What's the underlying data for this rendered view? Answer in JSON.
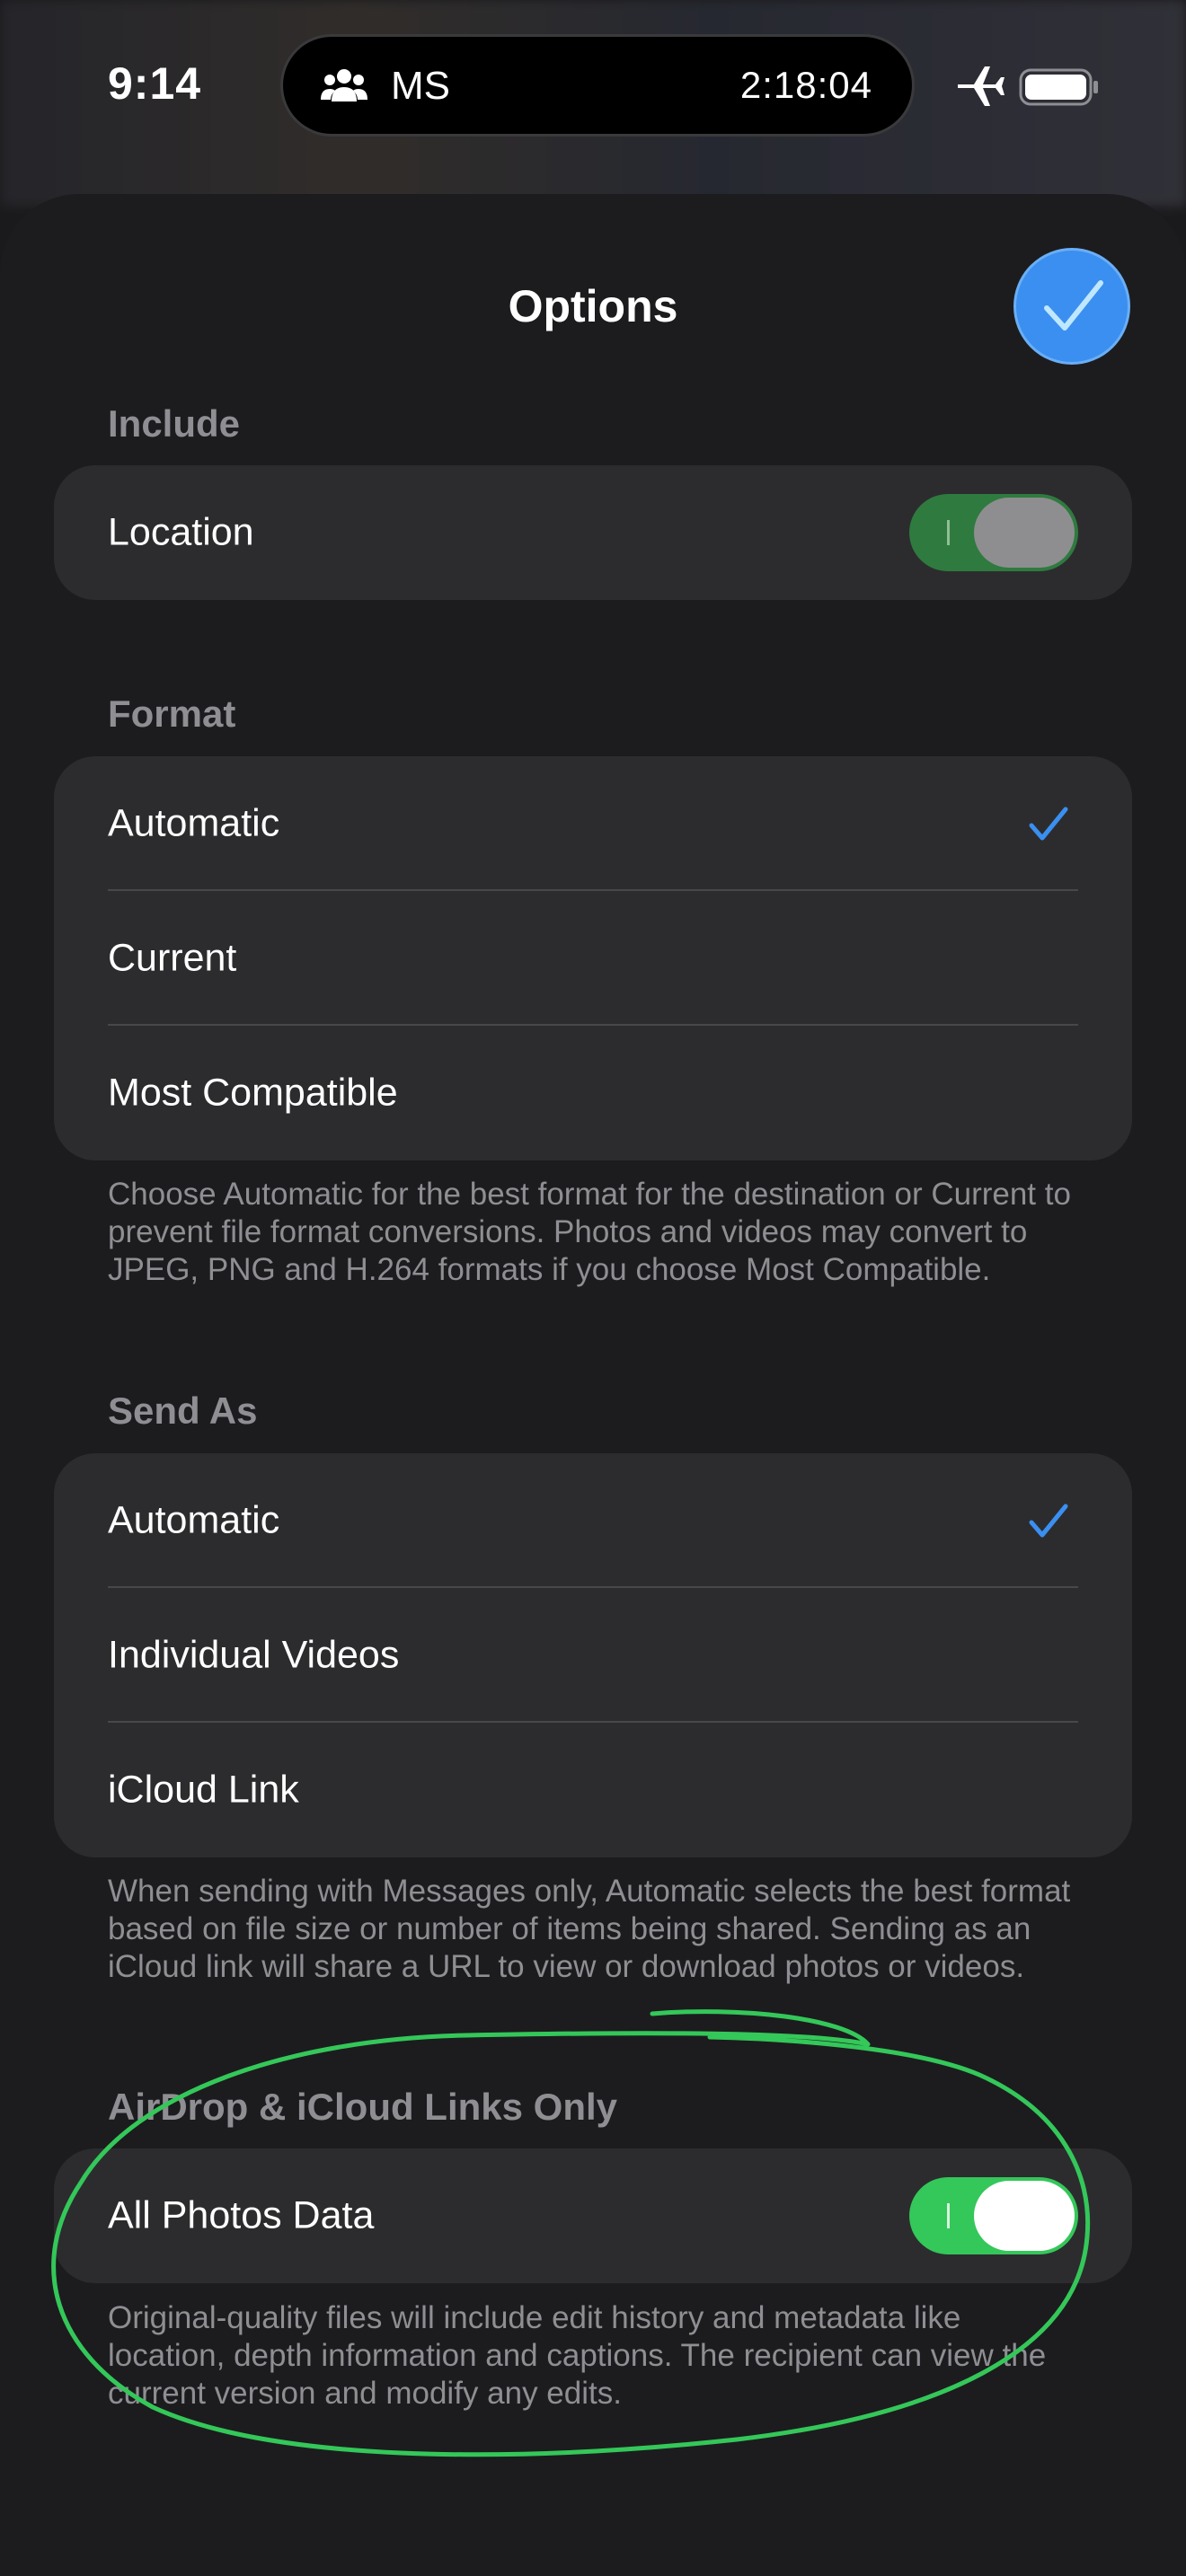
{
  "status_bar": {
    "time": "9:14",
    "island_label": "MS",
    "island_timer": "2:18:04",
    "icons": [
      "people-icon",
      "airplane-icon",
      "battery-icon"
    ]
  },
  "sheet": {
    "title": "Options",
    "done_icon": "checkmark-icon",
    "accent_color": "#3a8ff0"
  },
  "include": {
    "header": "Include",
    "location_label": "Location",
    "location_toggle": "on-dimmed"
  },
  "format": {
    "header": "Format",
    "options": [
      {
        "label": "Automatic",
        "selected": true
      },
      {
        "label": "Current",
        "selected": false
      },
      {
        "label": "Most Compatible",
        "selected": false
      }
    ],
    "footnote": "Choose Automatic for the best format for the destination or Current to prevent file format conversions. Photos and videos may convert to JPEG, PNG and H.264 formats if you choose Most Compatible."
  },
  "send_as": {
    "header": "Send As",
    "options": [
      {
        "label": "Automatic",
        "selected": true
      },
      {
        "label": "Individual Videos",
        "selected": false
      },
      {
        "label": "iCloud Link",
        "selected": false
      }
    ],
    "footnote": "When sending with Messages only, Automatic selects the best format based on file size or number of items being shared. Sending as an iCloud link will share a URL to view or download photos or videos."
  },
  "airdrop": {
    "header": "AirDrop & iCloud Links Only",
    "all_photos_label": "All Photos Data",
    "all_photos_toggle": "on",
    "footnote": "Original-quality files will include edit history and metadata like location, depth information and captions. The recipient can view the current version and modify any edits."
  },
  "colors": {
    "toggle_on": "#34c759",
    "annotation_stroke": "#34c759"
  }
}
